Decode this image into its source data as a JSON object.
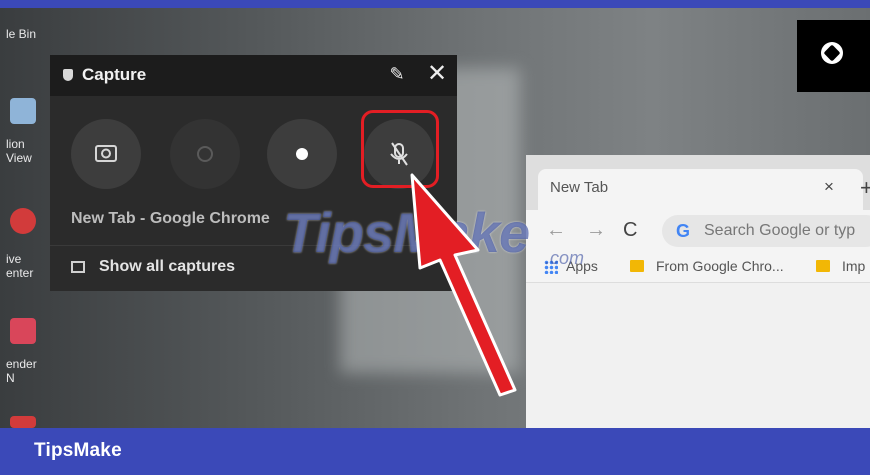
{
  "footer": {
    "brand": "TipsMake"
  },
  "desktop": {
    "labels": [
      "le Bin",
      "lion",
      "View",
      "ive",
      "enter",
      "ender",
      "N"
    ]
  },
  "capture": {
    "title": "Capture",
    "app_name": "New Tab - Google Chrome",
    "show_all": "Show all captures",
    "pin_icon": "pin-icon",
    "close_icon": "close-icon"
  },
  "chrome": {
    "tab_title": "New Tab",
    "tab_close": "×",
    "new_tab": "+",
    "omnibox_placeholder": "Search Google or typ",
    "bookmarks": [
      "Apps",
      "From Google Chro...",
      "Imp"
    ]
  },
  "watermark": {
    "text": "TipsMake",
    "suffix": ".com"
  },
  "colors": {
    "frame": "#3b49b8",
    "highlight": "#e31e24",
    "arrow": "#e31e24"
  }
}
